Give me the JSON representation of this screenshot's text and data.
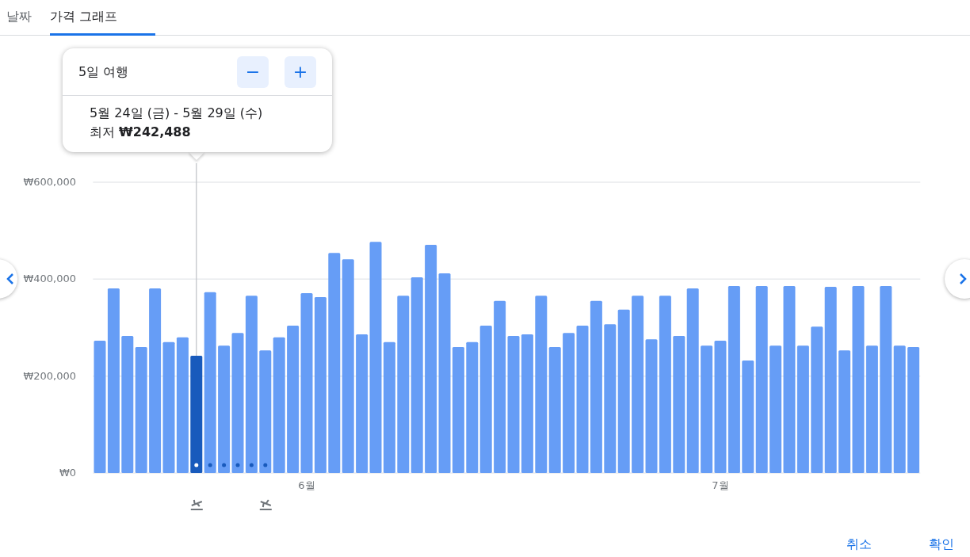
{
  "tabs": [
    {
      "label": "날짜",
      "selected": false
    },
    {
      "label": "가격 그래프",
      "selected": true
    }
  ],
  "popup": {
    "title": "5일 여행",
    "decrease": "−",
    "increase": "+",
    "dates": "5월 24일 (금) - 5월 29일 (수)",
    "price": "최저 **₩242,488**"
  },
  "chart": {
    "chart_data": {
      "type": "bar",
      "categories": [
        null,
        null,
        null,
        null,
        null,
        null,
        null,
        null,
        null,
        null,
        null,
        null,
        null,
        null,
        null,
        "6월",
        null,
        null,
        null,
        null,
        null,
        null,
        null,
        null,
        null,
        null,
        null,
        null,
        null,
        null,
        null,
        null,
        null,
        null,
        null,
        null,
        null,
        null,
        null,
        null,
        null,
        null,
        null,
        null,
        null,
        "7월",
        null,
        null,
        null,
        null,
        null,
        null,
        null,
        null,
        null,
        null,
        null,
        null,
        null,
        null
      ],
      "series": [
        {
          "color": "#669df6",
          "values": [
            273000,
            381000,
            283000,
            260000,
            381000,
            270000,
            280000,
            null,
            373000,
            263000,
            289000,
            366000,
            253000,
            280000,
            304000,
            371000,
            363000,
            454000,
            441000,
            286000,
            477000,
            270000,
            366000,
            404000,
            471000,
            412000,
            260000,
            270000,
            304000,
            355000,
            283000,
            286000,
            366000,
            260000,
            289000,
            304000,
            355000,
            307000,
            337000,
            366000,
            276000,
            366000,
            283000,
            381000,
            263000,
            273000,
            386000,
            232000,
            386000,
            263000,
            386000,
            263000,
            302000,
            384000,
            253000,
            386000,
            263000,
            386000,
            263000,
            260000
          ]
        },
        {
          "color": "#185abc",
          "values": [
            null,
            null,
            null,
            null,
            null,
            null,
            null,
            242000,
            null,
            null,
            null,
            null,
            null,
            null,
            null,
            null,
            null,
            null,
            null,
            null,
            null,
            null,
            null,
            null,
            null,
            null,
            null,
            null,
            null,
            null,
            null,
            null,
            null,
            null,
            null,
            null,
            null,
            null,
            null,
            null,
            null,
            null,
            null,
            null,
            null,
            null,
            null,
            null,
            null,
            null,
            null,
            null,
            null,
            null,
            null,
            null,
            null,
            null,
            null,
            null
          ]
        }
      ],
      "ylim": [
        0,
        600000
      ],
      "yticks": [
        {
          "value": 0,
          "label": "₩0"
        },
        {
          "value": 200000,
          "label": "₩200,000"
        },
        {
          "value": 400000,
          "label": "₩400,000"
        },
        {
          "value": 600000,
          "label": "₩600,000"
        }
      ]
    },
    "trip_dots": [
      {
        "selected": true
      },
      {
        "selected": false
      },
      {
        "selected": false
      },
      {
        "selected": false
      },
      {
        "selected": false
      },
      {
        "selected": false
      }
    ]
  },
  "buttons": [
    "취소",
    "확인"
  ]
}
